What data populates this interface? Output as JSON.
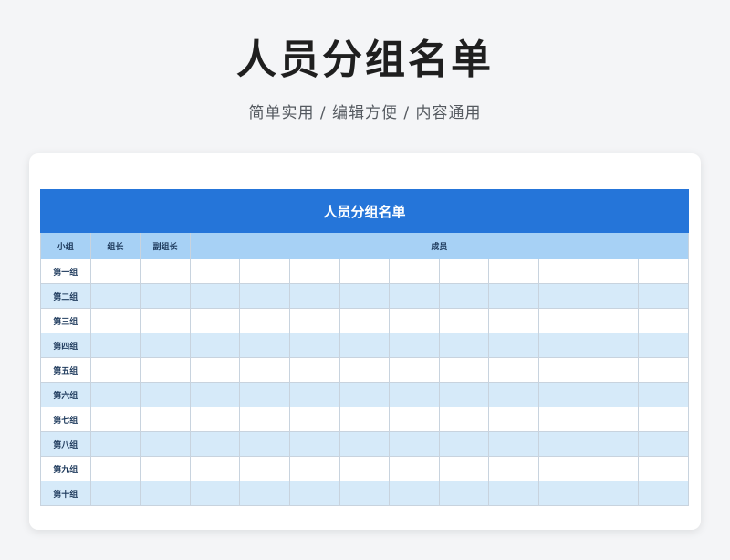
{
  "page": {
    "title": "人员分组名单",
    "subtitle": "简单实用 / 编辑方便 / 内容通用"
  },
  "sheet": {
    "banner": "人员分组名单",
    "headers": {
      "group": "小组",
      "leader": "组长",
      "deputy": "副组长",
      "members": "成员"
    },
    "member_columns": 10,
    "rows": [
      "第一组",
      "第二组",
      "第三组",
      "第四组",
      "第五组",
      "第六组",
      "第七组",
      "第八组",
      "第九组",
      "第十组"
    ]
  },
  "colors": {
    "banner": "#2575d9",
    "header": "#a7d1f5",
    "stripe": "#d6eaf9"
  }
}
